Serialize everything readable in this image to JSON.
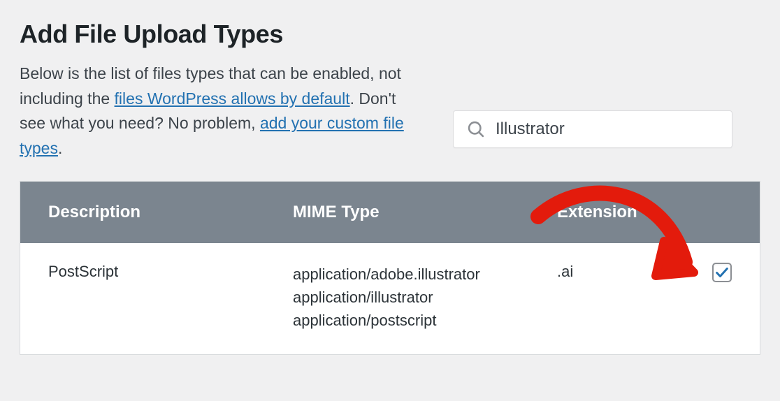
{
  "page_title": "Add File Upload Types",
  "description": {
    "prefix": "Below is the list of files types that can be enabled, not including the ",
    "link1_text": "files WordPress allows by default",
    "middle": ". Don't see what you need? No problem, ",
    "link2_text": "add your custom file types",
    "suffix": "."
  },
  "search": {
    "value": "Illustrator"
  },
  "table": {
    "headers": {
      "description": "Description",
      "mime": "MIME Type",
      "extension": "Extension"
    },
    "rows": [
      {
        "description": "PostScript",
        "mime": "application/adobe.illustrator\napplication/illustrator\napplication/postscript",
        "extension": ".ai",
        "checked": true
      }
    ]
  }
}
